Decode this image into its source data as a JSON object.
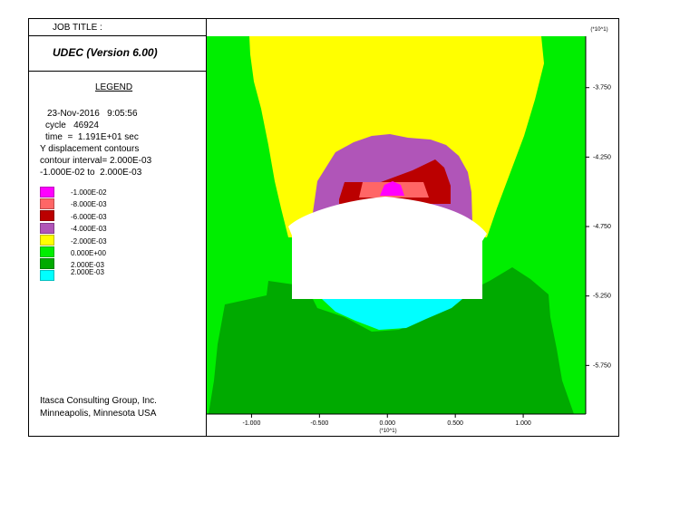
{
  "header": {
    "job_title": "JOB TITLE :",
    "program": "UDEC (Version 6.00)",
    "scale_top": "(*10^1)"
  },
  "legend": {
    "title": "LEGEND",
    "date_time": "23-Nov-2016   9:05:56",
    "cycle": "cycle   46924",
    "time": "time  =  1.191E+01 sec",
    "plot_desc": "Y displacement contours",
    "contour_interval": "contour interval= 2.000E-03",
    "range": "-1.000E-02 to  2.000E-03",
    "items": [
      {
        "label": "-1.000E-02",
        "color": "#ff00ff"
      },
      {
        "label": "-8.000E-03",
        "color": "#ff6666"
      },
      {
        "label": "-6.000E-03",
        "color": "#bb0000"
      },
      {
        "label": "-4.000E-03",
        "color": "#b055b8"
      },
      {
        "label": "-2.000E-03",
        "color": "#ffff00"
      },
      {
        "label": "0.000E+00",
        "color": "#00ee00"
      },
      {
        "label": "2.000E-03",
        "color": "#00aa00"
      },
      {
        "label": "2.000E-03",
        "color": "#00ffff"
      }
    ]
  },
  "footer": {
    "company": "Itasca Consulting Group, Inc.",
    "city": "Minneapolis, Minnesota  USA"
  },
  "chart_data": {
    "type": "heatmap",
    "variable": "Y displacement contours",
    "x": {
      "ticks": [
        -1.0,
        -0.5,
        0.0,
        0.5,
        1.0
      ],
      "tick_labels": [
        "-1.000",
        "-0.500",
        "0.000",
        "0.500",
        "1.000"
      ],
      "range": [
        -1.33,
        1.46
      ],
      "multiplier_label": "(*10^1)"
    },
    "y": {
      "ticks": [
        -3.75,
        -4.25,
        -4.75,
        -5.25,
        -5.75
      ],
      "tick_labels": [
        "-3.750",
        "-4.250",
        "-4.750",
        "-5.250",
        "-5.750"
      ],
      "range": [
        -6.1,
        -3.38
      ],
      "multiplier_label": "(*10^1)"
    },
    "contour_levels": [
      -0.01,
      -0.008,
      -0.006,
      -0.004,
      -0.002,
      0.0,
      0.002
    ],
    "contour_interval": 0.002,
    "value_range": [
      -0.01,
      0.002
    ],
    "grid": false
  }
}
